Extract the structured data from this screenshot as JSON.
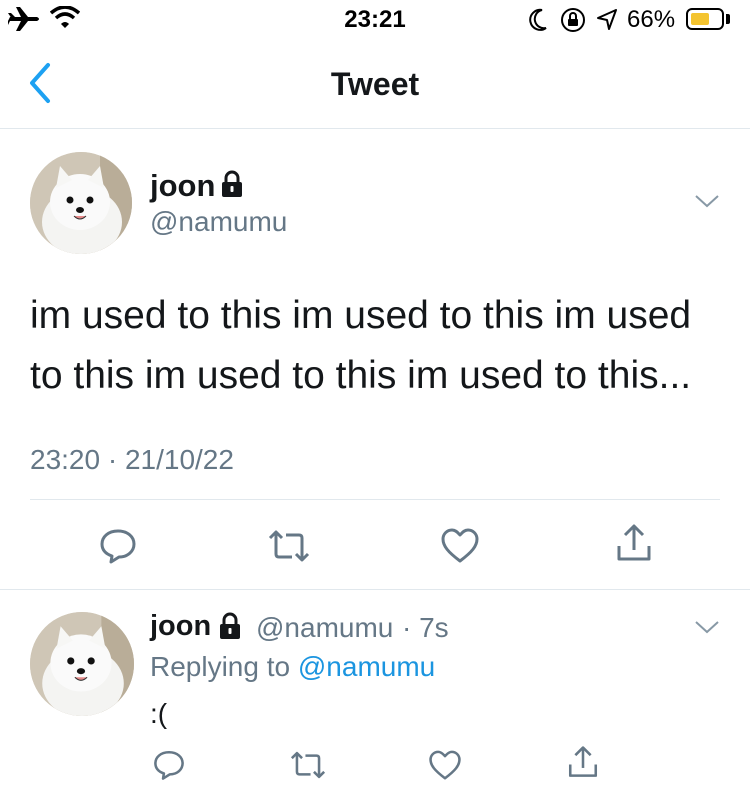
{
  "status_bar": {
    "time": "23:21",
    "battery_percent": "66%",
    "battery_level": 0.66,
    "icons": [
      "airplane-icon",
      "wifi-icon",
      "moon-icon",
      "rotation-lock-icon",
      "location-icon",
      "battery-icon"
    ],
    "battery_color": "#f4c430"
  },
  "nav": {
    "title": "Tweet",
    "back_icon": "chevron-left-icon",
    "accent_color": "#1da1f2"
  },
  "main_tweet": {
    "name": "joon",
    "handle": "@namumu",
    "text": "im used to this im used to this im used to this im used to this im used to this...",
    "timestamp": "23:20 · 21/10/22",
    "actions": [
      "reply-icon",
      "retweet-icon",
      "like-icon",
      "share-icon"
    ]
  },
  "reply_tweet": {
    "name": "joon",
    "handle": "@namumu",
    "time_ago": "· 7s",
    "replying_prefix": "Replying to",
    "replying_to": "@namumu",
    "text": ":(",
    "actions": [
      "reply-icon",
      "retweet-icon",
      "like-icon",
      "share-icon"
    ]
  }
}
